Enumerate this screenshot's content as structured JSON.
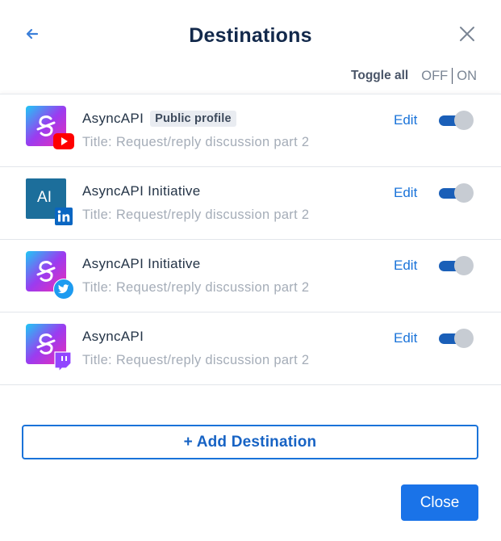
{
  "header": {
    "title": "Destinations",
    "back_icon": "arrow-left-icon",
    "close_icon": "close-icon"
  },
  "toggle_all": {
    "label": "Toggle all",
    "off": "OFF",
    "on": "ON"
  },
  "destinations": [
    {
      "name": "AsyncAPI",
      "pill": "Public profile",
      "subtitle": "Title: Request/reply discussion part 2",
      "edit_label": "Edit",
      "network": "youtube",
      "enabled": true
    },
    {
      "name": "AsyncAPI Initiative",
      "avatar_text": "AI",
      "subtitle": "Title: Request/reply discussion part 2",
      "edit_label": "Edit",
      "network": "linkedin",
      "enabled": true
    },
    {
      "name": "AsyncAPI Initiative",
      "subtitle": "Title: Request/reply discussion part 2",
      "edit_label": "Edit",
      "network": "twitter",
      "enabled": true
    },
    {
      "name": "AsyncAPI",
      "subtitle": "Title: Request/reply discussion part 2",
      "edit_label": "Edit",
      "network": "twitch",
      "enabled": true
    }
  ],
  "footer": {
    "add_label": "+ Add Destination",
    "close_label": "Close"
  },
  "colors": {
    "accent": "#1a73e8",
    "title": "#13294b",
    "muted": "#a5adb8",
    "toggle_on": "#1a5fb8"
  }
}
